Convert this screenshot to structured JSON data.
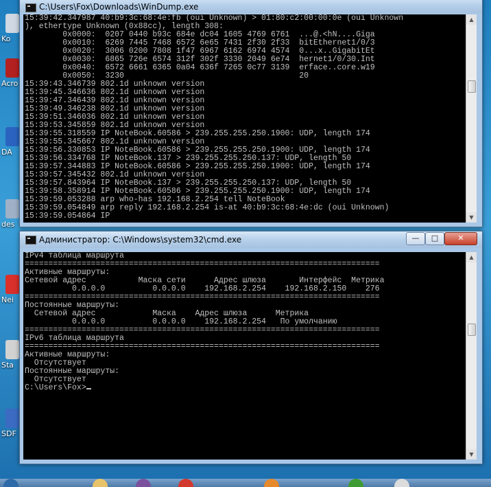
{
  "desktop": {
    "icons": [
      {
        "label": "Ko",
        "color": "#cfd8e3"
      },
      {
        "label": "Acro",
        "color": "#b32020"
      },
      {
        "label": "DA",
        "color": "#2b64c0"
      },
      {
        "label": "des",
        "color": "#9fb1c7"
      },
      {
        "label": "Nei",
        "color": "#d9302a"
      },
      {
        "label": "Sta",
        "color": "#d2d2d2"
      },
      {
        "label": "SDF",
        "color": "#3b6bc2"
      }
    ]
  },
  "windump_window": {
    "title": "C:\\Users\\Fox\\Downloads\\WinDump.exe",
    "lines": [
      "15:39:42.347987 40:b9:3c:68:4e:fb (oui Unknown) > 01:80:c2:00:00:0e (oui Unknown",
      "), ethertype Unknown (0x88cc), length 308:",
      "        0x0000:  0207 0440 b93c 684e dc04 1605 4769 6761  ...@.<hN....Giga",
      "        0x0010:  6269 7445 7468 6572 6e65 7431 2f30 2f33  bitEthernet1/0/3",
      "        0x0020:  3006 0200 7808 1f47 6967 6162 6974 4574  0...x..GigabitEt",
      "        0x0030:  6865 726e 6574 312f 302f 3330 2049 6e74  hernet1/0/30.Int",
      "        0x0040:  6572 6661 6365 0a04 636f 7265 0c77 3139  erface..core.w19",
      "        0x0050:  3230                                     20",
      "15:39:43.346739 802.1d unknown version",
      "15:39:45.346636 802.1d unknown version",
      "15:39:47.346439 802.1d unknown version",
      "15:39:49.346238 802.1d unknown version",
      "15:39:51.346036 802.1d unknown version",
      "15:39:53.345859 802.1d unknown version",
      "15:39:55.318559 IP NoteBook.60586 > 239.255.255.250.1900: UDP, length 174",
      "15:39:55.345667 802.1d unknown version",
      "15:39:56.330853 IP NoteBook.60586 > 239.255.255.250.1900: UDP, length 174",
      "15:39:56.334768 IP NoteBook.137 > 239.255.255.250.137: UDP, length 50",
      "15:39:57.344883 IP NoteBook.60586 > 239.255.255.250.1900: UDP, length 174",
      "15:39:57.345432 802.1d unknown version",
      "15:39:57.843964 IP NoteBook.137 > 239.255.255.250.137: UDP, length 50",
      "15:39:58.358914 IP NoteBook.60586 > 239.255.255.250.1900: UDP, length 174",
      "15:39:59.053288 arp who-has 192.168.2.254 tell NoteBook",
      "15:39:59.054849 arp reply 192.168.2.254 is-at 40:b9:3c:68:4e:dc (oui Unknown)",
      "15:39:59.054864 IP"
    ]
  },
  "cmd_window": {
    "title": "Администратор: C:\\Windows\\system32\\cmd.exe",
    "minimize": "—",
    "maximize": "□",
    "close": "✕",
    "lines": [
      "IPv4 таблица маршрута",
      "===========================================================================",
      "Активные маршруты:",
      "Сетевой адрес           Маска сети      Адрес шлюза       Интерфейс  Метрика",
      "          0.0.0.0          0.0.0.0    192.168.2.254    192.168.2.150    276",
      "===========================================================================",
      "Постоянные маршруты:",
      "  Сетевой адрес            Маска    Адрес шлюза      Метрика",
      "          0.0.0.0          0.0.0.0    192.168.2.254   По умолчанию",
      "===========================================================================",
      "",
      "IPv6 таблица маршрута",
      "===========================================================================",
      "Активные маршруты:",
      "  Отсутствует",
      "Постоянные маршруты:",
      "  Отсутствует",
      "",
      "C:\\Users\\Fox>"
    ]
  },
  "taskbar": {
    "items": [
      {
        "name": "start-orb",
        "color": "#2f6aa8"
      },
      {
        "name": "explorer",
        "color": "#e8c36a"
      },
      {
        "name": "viber",
        "color": "#7b519d"
      },
      {
        "name": "opera",
        "color": "#d23a2f"
      },
      {
        "name": "firefox",
        "color": "#e6892d"
      },
      {
        "name": "utorrent",
        "color": "#3f9c35"
      },
      {
        "name": "chrome",
        "color": "#dcdcdc"
      }
    ]
  }
}
